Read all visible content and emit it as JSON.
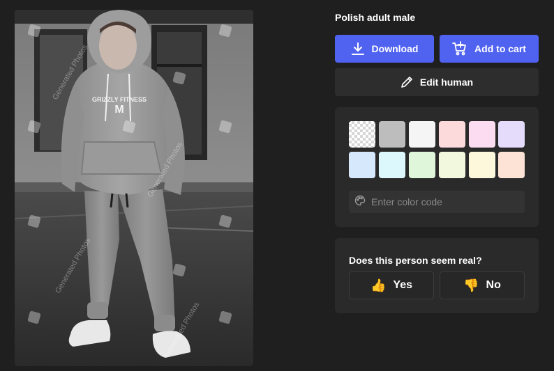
{
  "photo": {
    "alt": "Polish adult male",
    "watermark": "Generated Photos",
    "shirt_text": "GRIZZLY FITNESS"
  },
  "header": {
    "title": "Polish adult male"
  },
  "actions": {
    "download_label": "Download",
    "add_to_cart_label": "Add to cart",
    "edit_label": "Edit human"
  },
  "colors": {
    "swatches": [
      "transparent",
      "#bdbdbd",
      "#f5f5f5",
      "#fcd9db",
      "#fbdcf0",
      "#e5dcfc",
      "#d6e8fc",
      "#dcf8fc",
      "#dff6db",
      "#f1f8dd",
      "#fdf8dc",
      "#fde3d5"
    ],
    "placeholder": "Enter color code"
  },
  "feedback": {
    "question": "Does this person seem real?",
    "yes_emoji": "👍",
    "yes_label": "Yes",
    "no_emoji": "👎",
    "no_label": "No"
  },
  "theme": {
    "accent": "#5062f0",
    "background": "#1f1f1f",
    "card": "#2a2a2a"
  }
}
